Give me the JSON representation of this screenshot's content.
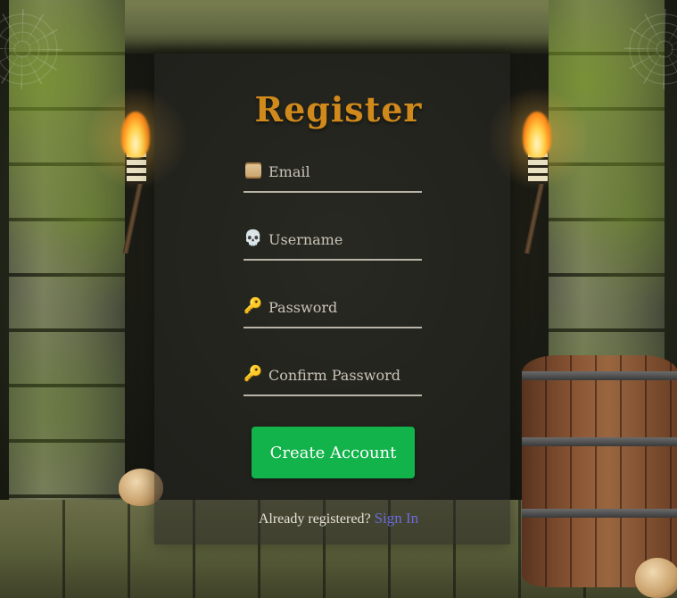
{
  "form": {
    "title": "Register",
    "fields": [
      {
        "icon": "scroll-icon",
        "placeholder": "Email",
        "value": ""
      },
      {
        "icon": "skull-icon",
        "glyph": "💀",
        "placeholder": "Username",
        "value": ""
      },
      {
        "icon": "key-icon",
        "glyph": "🔑",
        "placeholder": "Password",
        "value": ""
      },
      {
        "icon": "key-icon",
        "glyph": "🔑",
        "placeholder": "Confirm Password",
        "value": ""
      }
    ],
    "submit_label": "Create Account",
    "signin_prompt": "Already registered?",
    "signin_link": "Sign In"
  },
  "colors": {
    "title": "#d08a1c",
    "button": "#11b34a",
    "link": "#6b6bd9"
  }
}
